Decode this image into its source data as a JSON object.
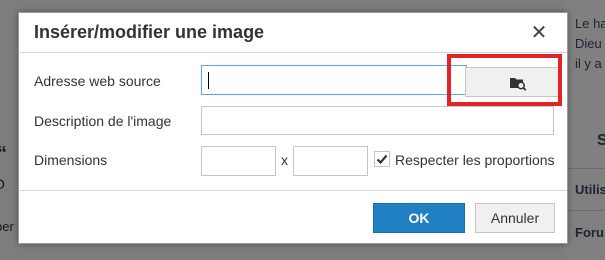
{
  "background": {
    "right_lines": [
      "Le ha",
      "Dieu",
      "il y a"
    ],
    "right_items": [
      "S",
      "Utilis",
      "Foru"
    ],
    "left_glyphs": [
      "“",
      "O",
      "per"
    ]
  },
  "dialog": {
    "title": "Insérer/modifier une image",
    "close_icon": "✕",
    "fields": {
      "source_label": "Adresse web source",
      "source_value": "",
      "description_label": "Description de l'image",
      "description_value": "",
      "dimensions_label": "Dimensions",
      "width_value": "",
      "height_value": "",
      "separator": "x",
      "constrain_label": "Respecter les proportions",
      "constrain_checked": true
    },
    "browse_icon": "folder-search-icon",
    "buttons": {
      "ok": "OK",
      "cancel": "Annuler"
    }
  },
  "colors": {
    "accent": "#2180c3",
    "highlight": "#e2232a",
    "focus": "#59a5e5"
  }
}
